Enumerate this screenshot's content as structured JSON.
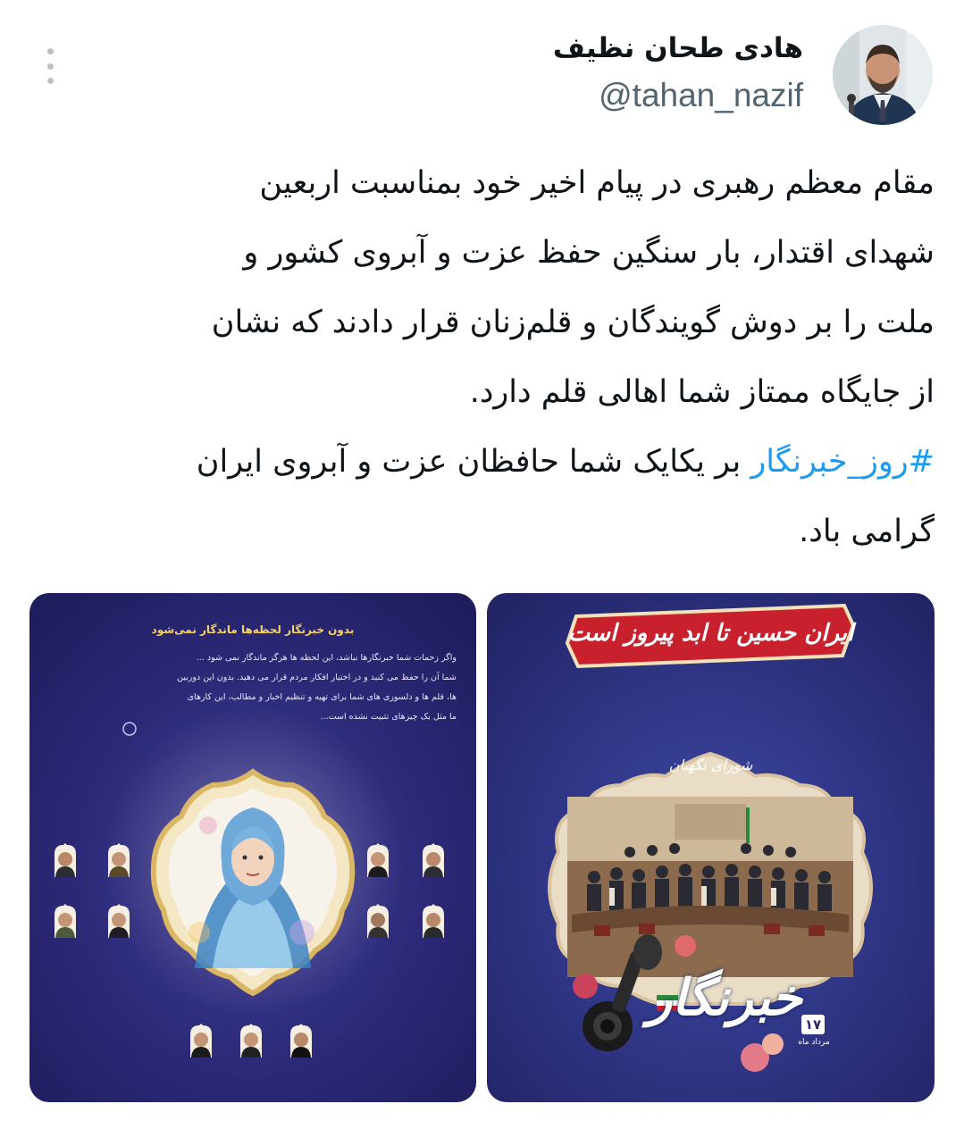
{
  "author": {
    "name": "هادی طحان نظیف",
    "handle": "@tahan_nazif"
  },
  "tweet": {
    "lines": [
      "مقام معظم رهبری در پیام اخیر خود بمناسبت اربعین",
      "شهدای اقتدار، بار سنگین حفظ عزت و آبروی کشور و",
      "ملت را بر دوش گویندگان و قلم‌زنان قرار دادند که نشان",
      "از جایگاه ممتاز شما اهالی قلم دارد."
    ],
    "hashtag": "#روز_خبرنگار",
    "line5_rest": " بر یکایک شما حافظان عزت و آبروی ایران",
    "line6": "گرامی باد."
  },
  "media": {
    "left": {
      "title": "بدون خبرنگار لحظه‌ها ماندگار نمی‌شود",
      "paragraph": [
        "واگر زحمات شما خبرنگارها نباشد، این لحظه ها هرگز ماندگار نمی شود ...",
        "شما آن را حفظ می کنید و در اختیار افکار مردم قرار می دهید. بدون این دوربین",
        "ها، قلم ها و دلسوزی های شما برای تهیه و تنظیم اخبار و مطالب، این کارهای",
        "ما مثل یک چیزهای تثبیت نشده است..."
      ]
    },
    "right": {
      "banner": "ایران حسین تا ابد پیروز است",
      "council": "شورای نگهبان",
      "day_word": "خبرنگار",
      "date_number": "۱۷",
      "date_month": "مرداد ماه"
    }
  },
  "colors": {
    "text": "#0f1419",
    "secondary": "#536471",
    "link": "#1d9bf0",
    "poster_bg": "#2c2b78",
    "banner_red": "#c8202c"
  },
  "icons": [
    "more-vertical-icon"
  ]
}
